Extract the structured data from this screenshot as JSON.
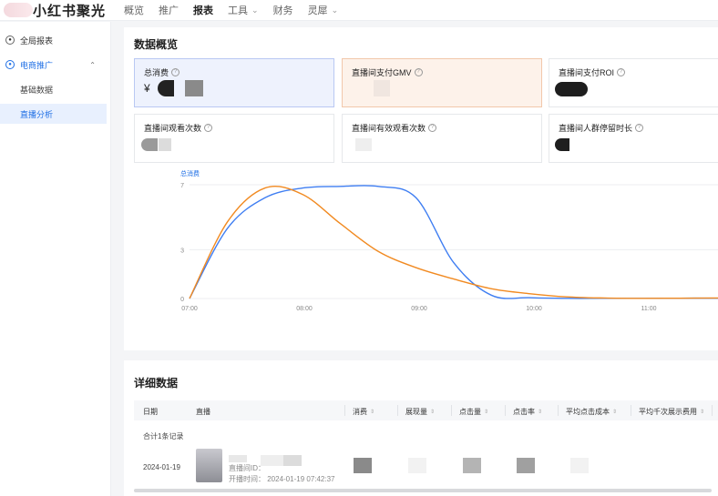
{
  "app": {
    "brand": "小红书聚光"
  },
  "nav": {
    "items": [
      {
        "label": "概览",
        "active": false,
        "caret": false
      },
      {
        "label": "推广",
        "active": false,
        "caret": false
      },
      {
        "label": "报表",
        "active": true,
        "caret": false
      },
      {
        "label": "工具",
        "active": false,
        "caret": true
      },
      {
        "label": "财务",
        "active": false,
        "caret": false
      },
      {
        "label": "灵犀",
        "active": false,
        "caret": true
      }
    ]
  },
  "sidebar": {
    "global_report": "全局报表",
    "group_label": "电商推广",
    "sub_items": [
      "基础数据",
      "直播分析"
    ],
    "active_sub": "直播分析"
  },
  "overview": {
    "title": "数据概览",
    "cards": [
      {
        "label": "总消费",
        "value_prefix": "¥"
      },
      {
        "label": "直播间支付GMV",
        "value_prefix": ""
      },
      {
        "label": "直播间支付ROI",
        "value_prefix": ""
      },
      {
        "label": "直播间观看次数",
        "value_prefix": ""
      },
      {
        "label": "直播间有效观看次数",
        "value_prefix": ""
      },
      {
        "label": "直播间人群停留时长",
        "value_prefix": ""
      }
    ]
  },
  "chart_data": {
    "type": "line",
    "legend_label": "总消费",
    "x": [
      "07:00",
      "08:00",
      "09:00",
      "10:00",
      "11:00"
    ],
    "y_ticks": [
      "0",
      "3",
      "7"
    ],
    "series": [
      {
        "color": "#3f7ef2",
        "values": [
          0,
          4.3,
          6.2,
          6.8,
          6.9,
          6.9,
          6.2,
          2.2,
          0.2,
          0.05,
          0.01,
          0.01,
          0.01,
          0.02,
          0.02
        ]
      },
      {
        "color": "#f18a21",
        "values": [
          0,
          4.7,
          6.8,
          6.4,
          4.6,
          2.9,
          1.9,
          1.2,
          0.6,
          0.3,
          0.1,
          0.03,
          0.01,
          0.02,
          0.03
        ]
      }
    ],
    "ylim": [
      0,
      7
    ]
  },
  "detail": {
    "title": "详细数据",
    "columns": [
      "日期",
      "直播",
      "消费",
      "展现量",
      "点击量",
      "点击率",
      "平均点击成本",
      "平均千次展示费用"
    ],
    "summary": "合计1条记录",
    "row": {
      "date": "2024-01-19",
      "room_id_label": "直播间ID：",
      "start_time": "开播时间： 2024-01-19 07:42:37"
    }
  },
  "colors": {
    "accent": "#1f6fe5",
    "series_blue": "#3f7ef2",
    "series_orange": "#f18a21"
  }
}
